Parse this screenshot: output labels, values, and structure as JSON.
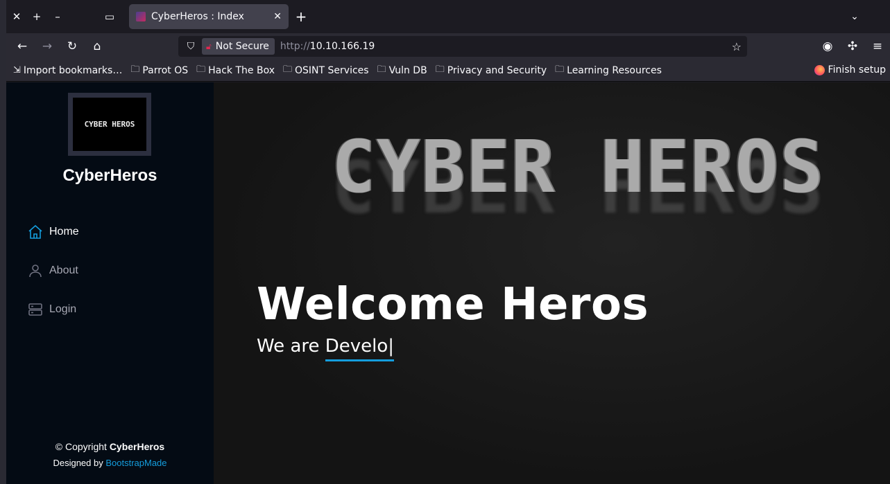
{
  "browser": {
    "tab": {
      "title": "CyberHeros : Index"
    },
    "url": {
      "badge": "Not Secure",
      "protocol": "http://",
      "host": "10.10.166.19"
    },
    "bookmarks": [
      {
        "label": "Import bookmarks…",
        "icon": "import-icon"
      },
      {
        "label": "Parrot OS",
        "icon": "folder-icon"
      },
      {
        "label": "Hack The Box",
        "icon": "folder-icon"
      },
      {
        "label": "OSINT Services",
        "icon": "folder-icon"
      },
      {
        "label": "Vuln DB",
        "icon": "folder-icon"
      },
      {
        "label": "Privacy and Security",
        "icon": "folder-icon"
      },
      {
        "label": "Learning Resources",
        "icon": "folder-icon"
      }
    ],
    "finish_setup": "Finish setup"
  },
  "sidebar": {
    "logo_text": "CYBER HEROS",
    "site_name": "CyberHeros",
    "nav": [
      {
        "label": "Home",
        "icon": "house-icon",
        "active": true
      },
      {
        "label": "About",
        "icon": "person-icon",
        "active": false
      },
      {
        "label": "Login",
        "icon": "server-icon",
        "active": false
      }
    ],
    "footer": {
      "copyright_prefix": "© Copyright ",
      "copyright_name": "CyberHeros",
      "designed_prefix": "Designed by ",
      "designed_link": "BootstrapMade"
    }
  },
  "hero": {
    "banner_text": "CYBER HEROS",
    "title": "Welcome Heros",
    "subtitle_prefix": "We are ",
    "typed_text": "Develo",
    "cursor": "|"
  },
  "colors": {
    "accent": "#149ddd",
    "sidebar_bg": "#040b14",
    "not_secure_lock": "#e22850"
  }
}
